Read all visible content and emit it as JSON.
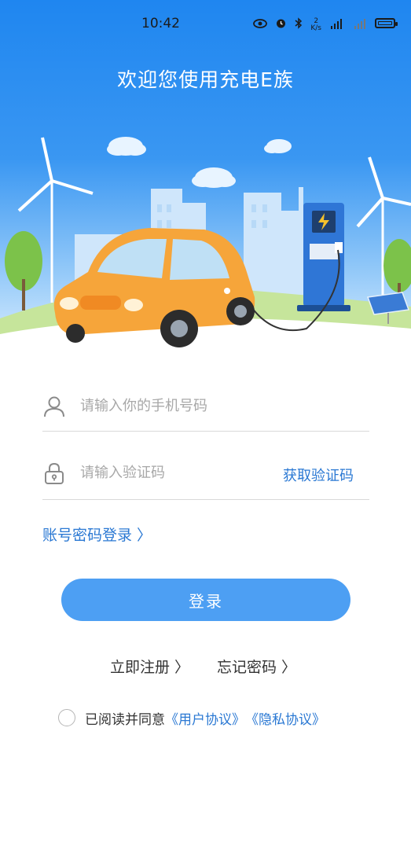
{
  "status_bar": {
    "time": "10:42",
    "net_speed_value": "2",
    "net_speed_unit": "K/s",
    "icons": [
      "eye-icon",
      "alarm-icon",
      "bluetooth-icon",
      "signal-5g-icon",
      "signal-icon",
      "battery-icon"
    ]
  },
  "hero": {
    "title": "欢迎您使用充电E族",
    "background_colors": [
      "#1f86f0",
      "#dcefff"
    ]
  },
  "form": {
    "phone_placeholder": "请输入你的手机号码",
    "code_placeholder": "请输入验证码",
    "get_code_label": "获取验证码",
    "account_login_label": "账号密码登录 〉",
    "login_button_label": "登录"
  },
  "links": {
    "register_label": "立即注册 〉",
    "forgot_label": "忘记密码 〉"
  },
  "agreement": {
    "prefix": "已阅读并同意",
    "user_agreement": "《用户协议》",
    "privacy_agreement": "《隐私协议》"
  },
  "colors": {
    "accent_blue": "#2a78d3",
    "button_blue": "#4d9ff3",
    "car_orange": "#f6a53a"
  }
}
